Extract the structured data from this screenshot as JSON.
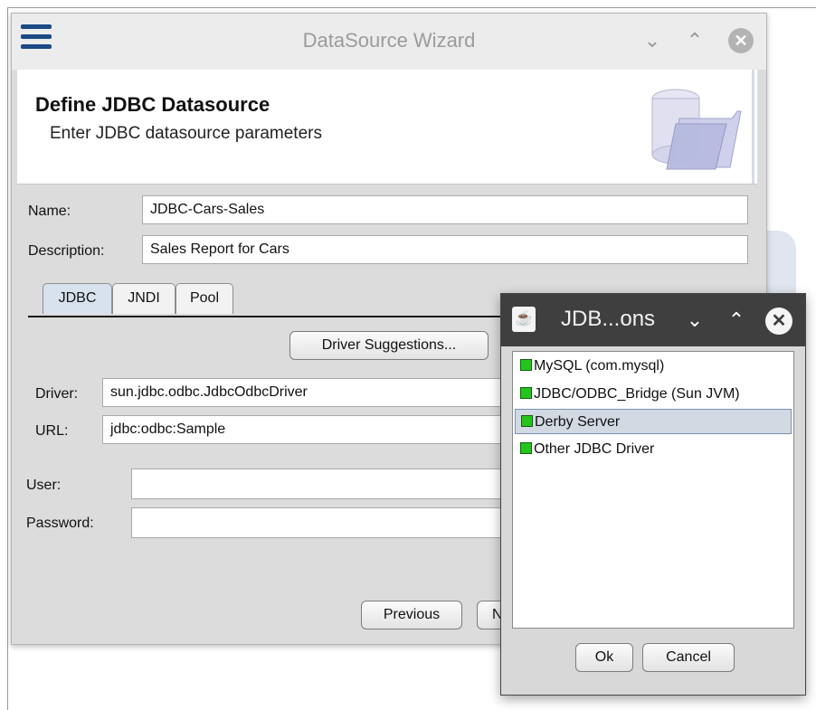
{
  "wizard": {
    "title": "DataSource Wizard",
    "controls": {
      "minimize": "⌄",
      "maximize": "⌃",
      "close": "✕"
    },
    "header": {
      "title": "Define JDBC Datasource",
      "subtitle": "Enter JDBC datasource parameters"
    },
    "name": {
      "label": "Name:",
      "value": "JDBC-Cars-Sales"
    },
    "description": {
      "label": "Description:",
      "value": "Sales Report for Cars"
    },
    "tabs": [
      {
        "label": "JDBC"
      },
      {
        "label": "JNDI"
      },
      {
        "label": "Pool"
      }
    ],
    "driver_suggestions_label": "Driver Suggestions...",
    "driver": {
      "label": "Driver:",
      "value": "sun.jdbc.odbc.JdbcOdbcDriver"
    },
    "url": {
      "label": "URL:",
      "value": "jdbc:odbc:Sample"
    },
    "user": {
      "label": "User:",
      "value": ""
    },
    "password": {
      "label": "Password:",
      "value": ""
    },
    "previous_label": "Previous",
    "next_label_partial": "N"
  },
  "popup": {
    "title": "JDB...ons",
    "controls": {
      "minimize": "⌄",
      "maximize": "⌃",
      "close": "✕"
    },
    "items": [
      {
        "label": "MySQL (com.mysql)"
      },
      {
        "label": "JDBC/ODBC_Bridge (Sun JVM)"
      },
      {
        "label": "Derby Server"
      },
      {
        "label": "Other JDBC Driver"
      }
    ],
    "selected_index": 2,
    "ok_label": "Ok",
    "cancel_label": "Cancel"
  },
  "colors": {
    "accent": "#1b4a86",
    "status_green": "#24c51e",
    "selection": "#d2d9e3"
  }
}
